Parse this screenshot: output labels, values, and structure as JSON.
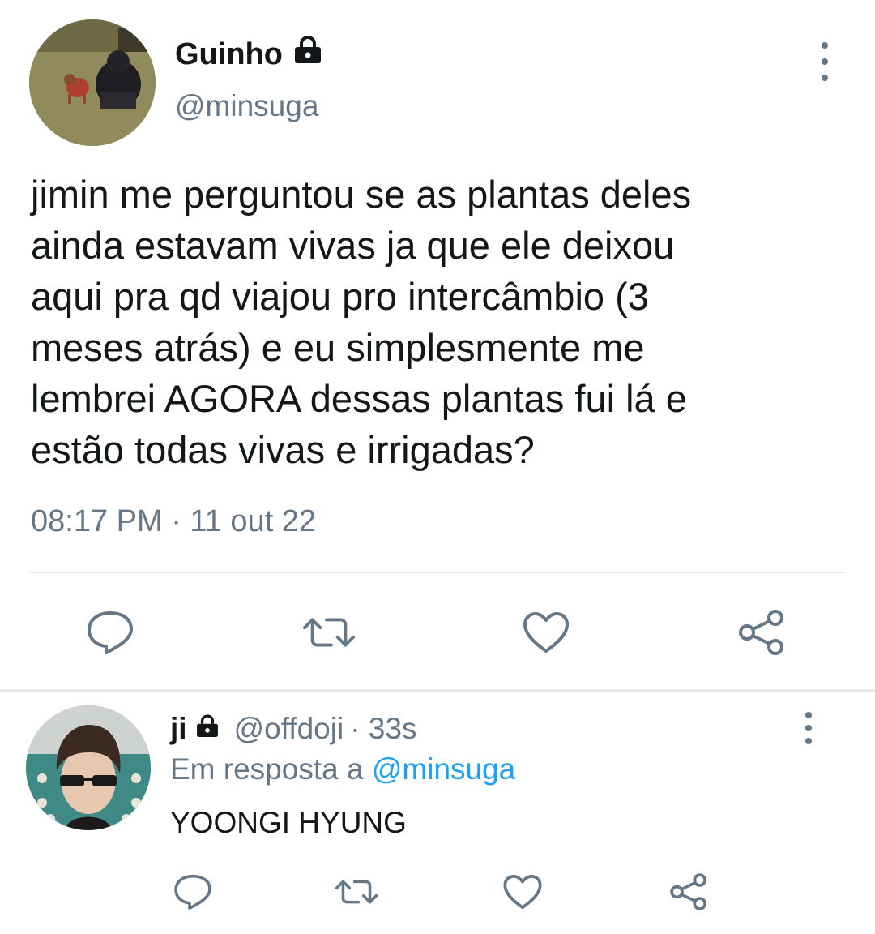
{
  "tweet": {
    "display_name": "Guinho",
    "handle": "@minsuga",
    "lock_icon": "lock-icon",
    "text": "jimin me perguntou se as plantas deles\nainda estavam vivas ja que ele deixou\naqui pra qd viajou pro intercâmbio (3\nmeses atrás) e eu simplesmente me\nlembrei AGORA dessas plantas fui lá e\nestão todas vivas e irrigadas?",
    "timestamp": "08:17 PM · 11 out 22",
    "actions": [
      "reply-icon",
      "retweet-icon",
      "like-icon",
      "share-icon"
    ]
  },
  "reply": {
    "display_name": "ji",
    "handle": "@offdoji",
    "age": "· 33s",
    "reply_prefix": "Em resposta a",
    "reply_mention": "@minsuga",
    "text": "YOONGI HYUNG"
  },
  "colors": {
    "text": "#14171a",
    "secondary": "#657786",
    "accent": "#1da1f2",
    "divider": "#e6ecf0"
  }
}
